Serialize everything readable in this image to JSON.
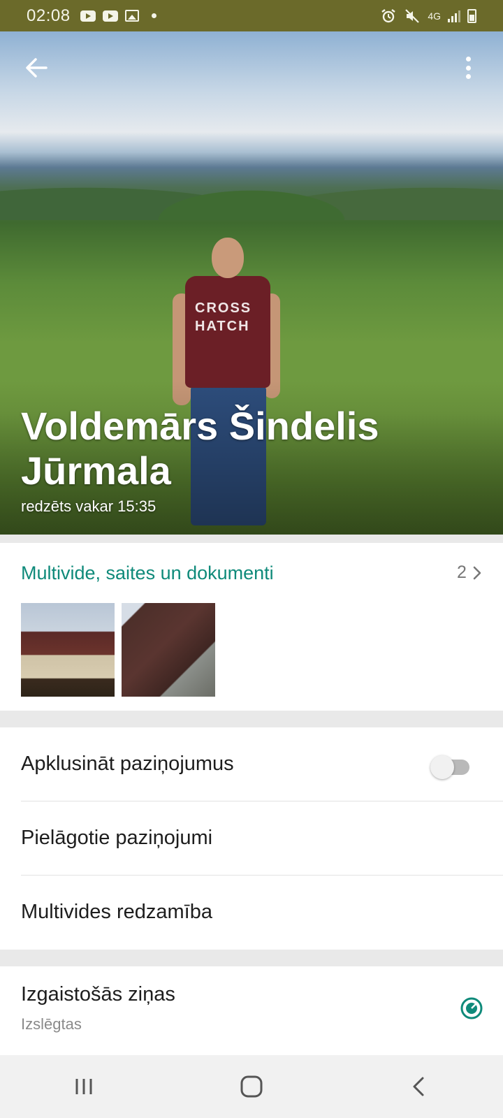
{
  "status_bar": {
    "time": "02:08",
    "left_icons": [
      "youtube-icon",
      "youtube-icon",
      "image-icon",
      "dot-icon"
    ],
    "right_icons": [
      "alarm-icon",
      "mute-icon",
      "4g-icon",
      "signal-icon",
      "battery-icon"
    ],
    "network": "4G",
    "bg_color": "#6b6a2a"
  },
  "header": {
    "back_icon": "back-arrow-icon",
    "menu_icon": "more-vert-icon"
  },
  "contact": {
    "name": "Voldemārs Šindelis Jūrmala",
    "last_seen": "redzēts vakar 15:35",
    "shirt_print": "CROSS HATCH"
  },
  "media": {
    "title": "Multivide, saites un dokumenti",
    "count": "2",
    "accent_color": "#0f8a7a",
    "thumbnails": [
      "house-photo",
      "roof-photo"
    ]
  },
  "settings": {
    "items": [
      {
        "label": "Apklusināt paziņojumus",
        "control": "toggle",
        "state": "off"
      },
      {
        "label": "Pielāgotie paziņojumi"
      },
      {
        "label": "Multivides redzamība"
      }
    ]
  },
  "disappearing": {
    "title": "Izgaistošās ziņas",
    "subtitle": "Izslēgtas",
    "icon": "timer-icon"
  },
  "nav_bar": {
    "buttons": [
      "recents-icon",
      "home-icon",
      "back-icon"
    ]
  }
}
